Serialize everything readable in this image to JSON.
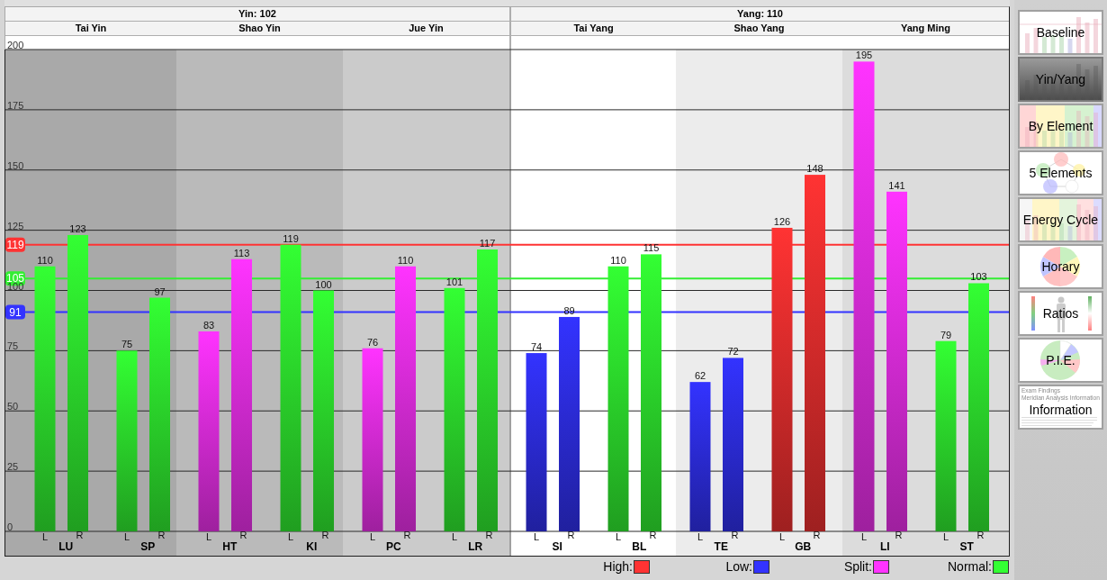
{
  "chart": {
    "halves": [
      {
        "label": "Yin: 102"
      },
      {
        "label": "Yang: 110"
      }
    ],
    "groups": [
      {
        "label": "Tai Yin",
        "color": "#a9a9a9"
      },
      {
        "label": "Shao Yin",
        "color": "#bababa"
      },
      {
        "label": "Jue Yin",
        "color": "#cbcbcb"
      },
      {
        "label": "Tai Yang",
        "color": "#ffffff"
      },
      {
        "label": "Shao Yang",
        "color": "#ececec"
      },
      {
        "label": "Yang Ming",
        "color": "#dcdcdc"
      }
    ],
    "meridians": [
      {
        "bars": [
          {
            "label": "L",
            "kind": "normal"
          },
          {
            "label": "R",
            "kind": "normal"
          }
        ]
      },
      {
        "bars": [
          {
            "label": "L",
            "kind": "normal"
          },
          {
            "label": "R",
            "kind": "normal"
          }
        ]
      },
      {
        "bars": [
          {
            "label": "L",
            "kind": "split"
          },
          {
            "label": "R",
            "kind": "split"
          }
        ]
      },
      {
        "bars": [
          {
            "label": "L",
            "kind": "normal"
          },
          {
            "label": "R",
            "kind": "normal"
          }
        ]
      },
      {
        "bars": [
          {
            "label": "L",
            "kind": "split"
          },
          {
            "label": "R",
            "kind": "split"
          }
        ]
      },
      {
        "bars": [
          {
            "label": "L",
            "kind": "normal"
          },
          {
            "label": "R",
            "kind": "normal"
          }
        ]
      },
      {
        "bars": [
          {
            "label": "L",
            "kind": "low"
          },
          {
            "label": "R",
            "kind": "low"
          }
        ]
      },
      {
        "bars": [
          {
            "label": "L",
            "kind": "normal"
          },
          {
            "label": "R",
            "kind": "normal"
          }
        ]
      },
      {
        "bars": [
          {
            "label": "L",
            "kind": "low"
          },
          {
            "label": "R",
            "kind": "low"
          }
        ]
      },
      {
        "bars": [
          {
            "label": "L",
            "kind": "high"
          },
          {
            "label": "R",
            "kind": "high"
          }
        ]
      },
      {
        "bars": [
          {
            "label": "L",
            "kind": "split"
          },
          {
            "label": "R",
            "kind": "split"
          }
        ]
      },
      {
        "bars": [
          {
            "label": "L",
            "kind": "normal"
          },
          {
            "label": "R",
            "kind": "normal"
          }
        ]
      }
    ],
    "chart_data": {
      "type": "bar",
      "categories": [
        "LU",
        "SP",
        "HT",
        "KI",
        "PC",
        "LR",
        "SI",
        "BL",
        "TE",
        "GB",
        "LI",
        "ST"
      ],
      "series": [
        {
          "values": [
            110,
            75,
            83,
            119,
            76,
            101,
            74,
            110,
            62,
            126,
            195,
            79
          ]
        },
        {
          "values": [
            123,
            97,
            113,
            100,
            110,
            117,
            89,
            115,
            72,
            148,
            141,
            103
          ]
        }
      ],
      "ylim": [
        0,
        200
      ],
      "yticks": [
        0,
        25,
        50,
        75,
        100,
        125,
        150,
        175,
        200
      ],
      "grid": true,
      "data_labels": true,
      "ref_lines": [
        {
          "axis": "y",
          "value": 119,
          "label": "119",
          "color": "#ff3333"
        },
        {
          "axis": "y",
          "value": 105,
          "label": "105",
          "color": "#33ee33"
        },
        {
          "axis": "y",
          "value": 91,
          "label": "91",
          "color": "#3333ff"
        }
      ]
    }
  },
  "legend": [
    {
      "label": "High:",
      "kind": "high",
      "color": "#ff3333"
    },
    {
      "label": "Low:",
      "kind": "low",
      "color": "#3333ff"
    },
    {
      "label": "Split:",
      "kind": "split",
      "color": "#ff33ff"
    },
    {
      "label": "Normal:",
      "kind": "normal",
      "color": "#33ff33"
    }
  ],
  "graphs": [
    {
      "label": "Baseline",
      "kind": "baseline",
      "selected": false
    },
    {
      "label": "Yin/Yang",
      "kind": "yinyang",
      "selected": true
    },
    {
      "label": "By Element",
      "kind": "element",
      "selected": false
    },
    {
      "label": "5 Elements",
      "kind": "five",
      "selected": false
    },
    {
      "label": "Energy Cycle",
      "kind": "cycle",
      "selected": false
    },
    {
      "label": "Horary",
      "kind": "horary",
      "selected": false
    },
    {
      "label": "Ratios",
      "kind": "ratios",
      "selected": false
    },
    {
      "label": "P.I.E.",
      "kind": "pie",
      "selected": false
    },
    {
      "label": "Information",
      "kind": "information",
      "selected": false,
      "preview_lines": [
        "Exam Findings",
        "Meridian Analysis Information"
      ]
    }
  ]
}
